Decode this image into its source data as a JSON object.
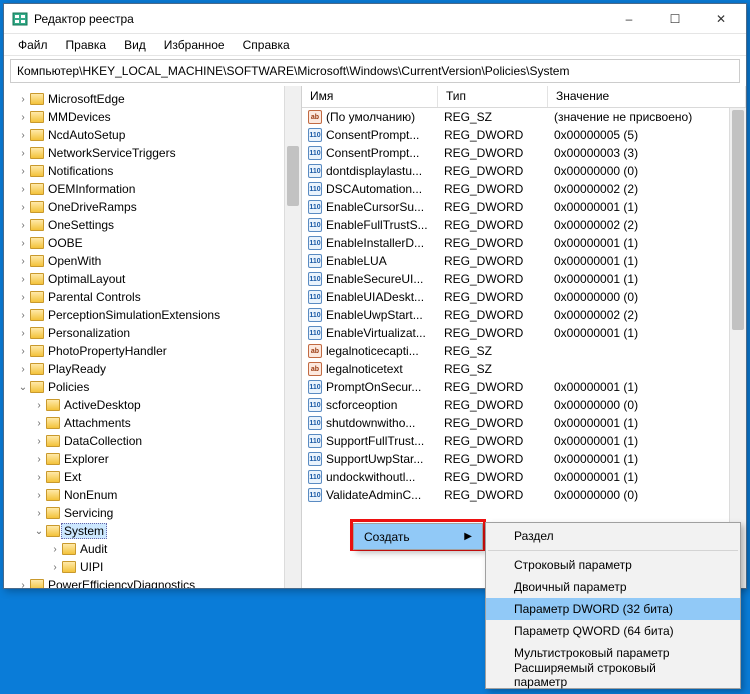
{
  "window": {
    "title": "Редактор реестра",
    "minimize": "–",
    "maximize": "☐",
    "close": "✕"
  },
  "menu": {
    "file": "Файл",
    "edit": "Правка",
    "view": "Вид",
    "favorites": "Избранное",
    "help": "Справка"
  },
  "path": "Компьютер\\HKEY_LOCAL_MACHINE\\SOFTWARE\\Microsoft\\Windows\\CurrentVersion\\Policies\\System",
  "columns": {
    "name": "Имя",
    "type": "Тип",
    "value": "Значение"
  },
  "tree": [
    {
      "label": "MicrosoftEdge",
      "level": 0
    },
    {
      "label": "MMDevices",
      "level": 0
    },
    {
      "label": "NcdAutoSetup",
      "level": 0
    },
    {
      "label": "NetworkServiceTriggers",
      "level": 0
    },
    {
      "label": "Notifications",
      "level": 0
    },
    {
      "label": "OEMInformation",
      "level": 0
    },
    {
      "label": "OneDriveRamps",
      "level": 0
    },
    {
      "label": "OneSettings",
      "level": 0
    },
    {
      "label": "OOBE",
      "level": 0
    },
    {
      "label": "OpenWith",
      "level": 0
    },
    {
      "label": "OptimalLayout",
      "level": 0
    },
    {
      "label": "Parental Controls",
      "level": 0
    },
    {
      "label": "PerceptionSimulationExtensions",
      "level": 0
    },
    {
      "label": "Personalization",
      "level": 0
    },
    {
      "label": "PhotoPropertyHandler",
      "level": 0
    },
    {
      "label": "PlayReady",
      "level": 0
    },
    {
      "label": "Policies",
      "level": 0,
      "expanded": true
    },
    {
      "label": "ActiveDesktop",
      "level": 1
    },
    {
      "label": "Attachments",
      "level": 1
    },
    {
      "label": "DataCollection",
      "level": 1
    },
    {
      "label": "Explorer",
      "level": 1
    },
    {
      "label": "Ext",
      "level": 1
    },
    {
      "label": "NonEnum",
      "level": 1
    },
    {
      "label": "Servicing",
      "level": 1
    },
    {
      "label": "System",
      "level": 1,
      "selected": true,
      "expanded": true
    },
    {
      "label": "Audit",
      "level": 2
    },
    {
      "label": "UIPI",
      "level": 2
    },
    {
      "label": "PowerEfficiencyDiagnostics",
      "level": 0
    }
  ],
  "values": [
    {
      "name": "(По умолчанию)",
      "type": "REG_SZ",
      "value": "(значение не присвоено)",
      "icon": "str"
    },
    {
      "name": "ConsentPrompt...",
      "type": "REG_DWORD",
      "value": "0x00000005 (5)",
      "icon": "bin"
    },
    {
      "name": "ConsentPrompt...",
      "type": "REG_DWORD",
      "value": "0x00000003 (3)",
      "icon": "bin"
    },
    {
      "name": "dontdisplaylastu...",
      "type": "REG_DWORD",
      "value": "0x00000000 (0)",
      "icon": "bin"
    },
    {
      "name": "DSCAutomation...",
      "type": "REG_DWORD",
      "value": "0x00000002 (2)",
      "icon": "bin"
    },
    {
      "name": "EnableCursorSu...",
      "type": "REG_DWORD",
      "value": "0x00000001 (1)",
      "icon": "bin"
    },
    {
      "name": "EnableFullTrustS...",
      "type": "REG_DWORD",
      "value": "0x00000002 (2)",
      "icon": "bin"
    },
    {
      "name": "EnableInstallerD...",
      "type": "REG_DWORD",
      "value": "0x00000001 (1)",
      "icon": "bin"
    },
    {
      "name": "EnableLUA",
      "type": "REG_DWORD",
      "value": "0x00000001 (1)",
      "icon": "bin"
    },
    {
      "name": "EnableSecureUI...",
      "type": "REG_DWORD",
      "value": "0x00000001 (1)",
      "icon": "bin"
    },
    {
      "name": "EnableUIADeskt...",
      "type": "REG_DWORD",
      "value": "0x00000000 (0)",
      "icon": "bin"
    },
    {
      "name": "EnableUwpStart...",
      "type": "REG_DWORD",
      "value": "0x00000002 (2)",
      "icon": "bin"
    },
    {
      "name": "EnableVirtualizat...",
      "type": "REG_DWORD",
      "value": "0x00000001 (1)",
      "icon": "bin"
    },
    {
      "name": "legalnoticecapti...",
      "type": "REG_SZ",
      "value": "",
      "icon": "str"
    },
    {
      "name": "legalnoticetext",
      "type": "REG_SZ",
      "value": "",
      "icon": "str"
    },
    {
      "name": "PromptOnSecur...",
      "type": "REG_DWORD",
      "value": "0x00000001 (1)",
      "icon": "bin"
    },
    {
      "name": "scforceoption",
      "type": "REG_DWORD",
      "value": "0x00000000 (0)",
      "icon": "bin"
    },
    {
      "name": "shutdownwitho...",
      "type": "REG_DWORD",
      "value": "0x00000001 (1)",
      "icon": "bin"
    },
    {
      "name": "SupportFullTrust...",
      "type": "REG_DWORD",
      "value": "0x00000001 (1)",
      "icon": "bin"
    },
    {
      "name": "SupportUwpStar...",
      "type": "REG_DWORD",
      "value": "0x00000001 (1)",
      "icon": "bin"
    },
    {
      "name": "undockwithoutl...",
      "type": "REG_DWORD",
      "value": "0x00000001 (1)",
      "icon": "bin"
    },
    {
      "name": "ValidateAdminC...",
      "type": "REG_DWORD",
      "value": "0x00000000 (0)",
      "icon": "bin"
    }
  ],
  "context_parent": {
    "create": "Создать"
  },
  "context_sub": {
    "key": "Раздел",
    "string": "Строковый параметр",
    "binary": "Двоичный параметр",
    "dword": "Параметр DWORD (32 бита)",
    "qword": "Параметр QWORD (64 бита)",
    "multi": "Мультистроковый параметр",
    "expand": "Расширяемый строковый параметр"
  }
}
